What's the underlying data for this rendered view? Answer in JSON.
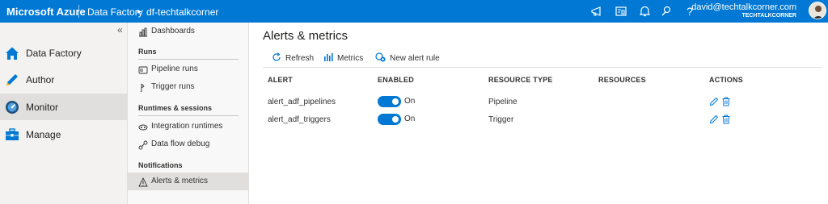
{
  "topbar": {
    "brand": "Microsoft Azure",
    "breadcrumb_1": "Data Factory",
    "breadcrumb_sep": "▸",
    "breadcrumb_2": "df-techtalkcorner",
    "user_email": "david@techtalkcorner.com",
    "user_org": "TECHTALKCORNER",
    "icons": [
      "announcement-icon",
      "directory-icon",
      "notifications-icon",
      "feedback-icon",
      "help-icon"
    ],
    "help_glyph": "?"
  },
  "leftnav": {
    "collapse_glyph": "«",
    "items": [
      {
        "label": "Data Factory",
        "icon": "home-icon"
      },
      {
        "label": "Author",
        "icon": "pencil-icon"
      },
      {
        "label": "Monitor",
        "icon": "gauge-icon",
        "active": true
      },
      {
        "label": "Manage",
        "icon": "toolbox-icon"
      }
    ]
  },
  "subnav": {
    "dashboards": "Dashboards",
    "runs_header": "Runs",
    "pipeline_runs": "Pipeline runs",
    "trigger_runs": "Trigger runs",
    "runtimes_header": "Runtimes & sessions",
    "integration_runtimes": "Integration runtimes",
    "data_flow_debug": "Data flow debug",
    "notifications_header": "Notifications",
    "alerts_metrics": "Alerts & metrics"
  },
  "main": {
    "title": "Alerts & metrics",
    "toolbar": {
      "refresh": "Refresh",
      "metrics": "Metrics",
      "new_alert_rule": "New alert rule"
    },
    "columns": [
      "ALERT",
      "ENABLED",
      "RESOURCE TYPE",
      "RESOURCES",
      "ACTIONS"
    ],
    "rows": [
      {
        "alert": "alert_adf_pipelines",
        "enabled": "On",
        "resource_type": "Pipeline",
        "resources": ""
      },
      {
        "alert": "alert_adf_triggers",
        "enabled": "On",
        "resource_type": "Trigger",
        "resources": ""
      }
    ]
  },
  "colors": {
    "accent": "#0078d4",
    "nav_bg": "#f3f2f1",
    "active_bg": "#e1dfdd"
  }
}
